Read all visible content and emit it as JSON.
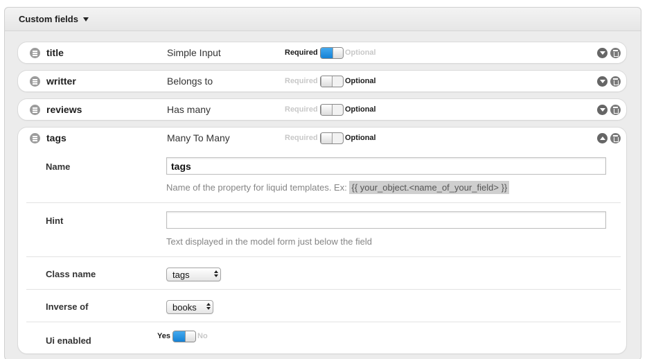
{
  "panel": {
    "title": "Custom fields",
    "caret_icon": "caret-down-icon"
  },
  "fields": [
    {
      "name": "title",
      "type": "Simple Input",
      "required_label": "Required",
      "optional_label": "Optional",
      "required": true,
      "expanded": false
    },
    {
      "name": "writter",
      "type": "Belongs to",
      "required_label": "Required",
      "optional_label": "Optional",
      "required": false,
      "expanded": false
    },
    {
      "name": "reviews",
      "type": "Has many",
      "required_label": "Required",
      "optional_label": "Optional",
      "required": false,
      "expanded": false
    },
    {
      "name": "tags",
      "type": "Many To Many",
      "required_label": "Required",
      "optional_label": "Optional",
      "required": false,
      "expanded": true
    }
  ],
  "details": {
    "name": {
      "label": "Name",
      "value": "tags",
      "hint_prefix": "Name of the property for liquid templates. Ex:",
      "hint_code": "{{ your_object.<name_of_your_field> }}"
    },
    "hint": {
      "label": "Hint",
      "value": "",
      "hint_text": "Text displayed in the model form just below the field"
    },
    "class_name": {
      "label": "Class name",
      "selected": "tags"
    },
    "inverse_of": {
      "label": "Inverse of",
      "selected": "books"
    },
    "ui_enabled": {
      "label": "Ui enabled",
      "yes_label": "Yes",
      "no_label": "No",
      "enabled": true
    }
  },
  "colors": {
    "toggle_on": "#1582d6",
    "accent": "#44a9ee"
  }
}
